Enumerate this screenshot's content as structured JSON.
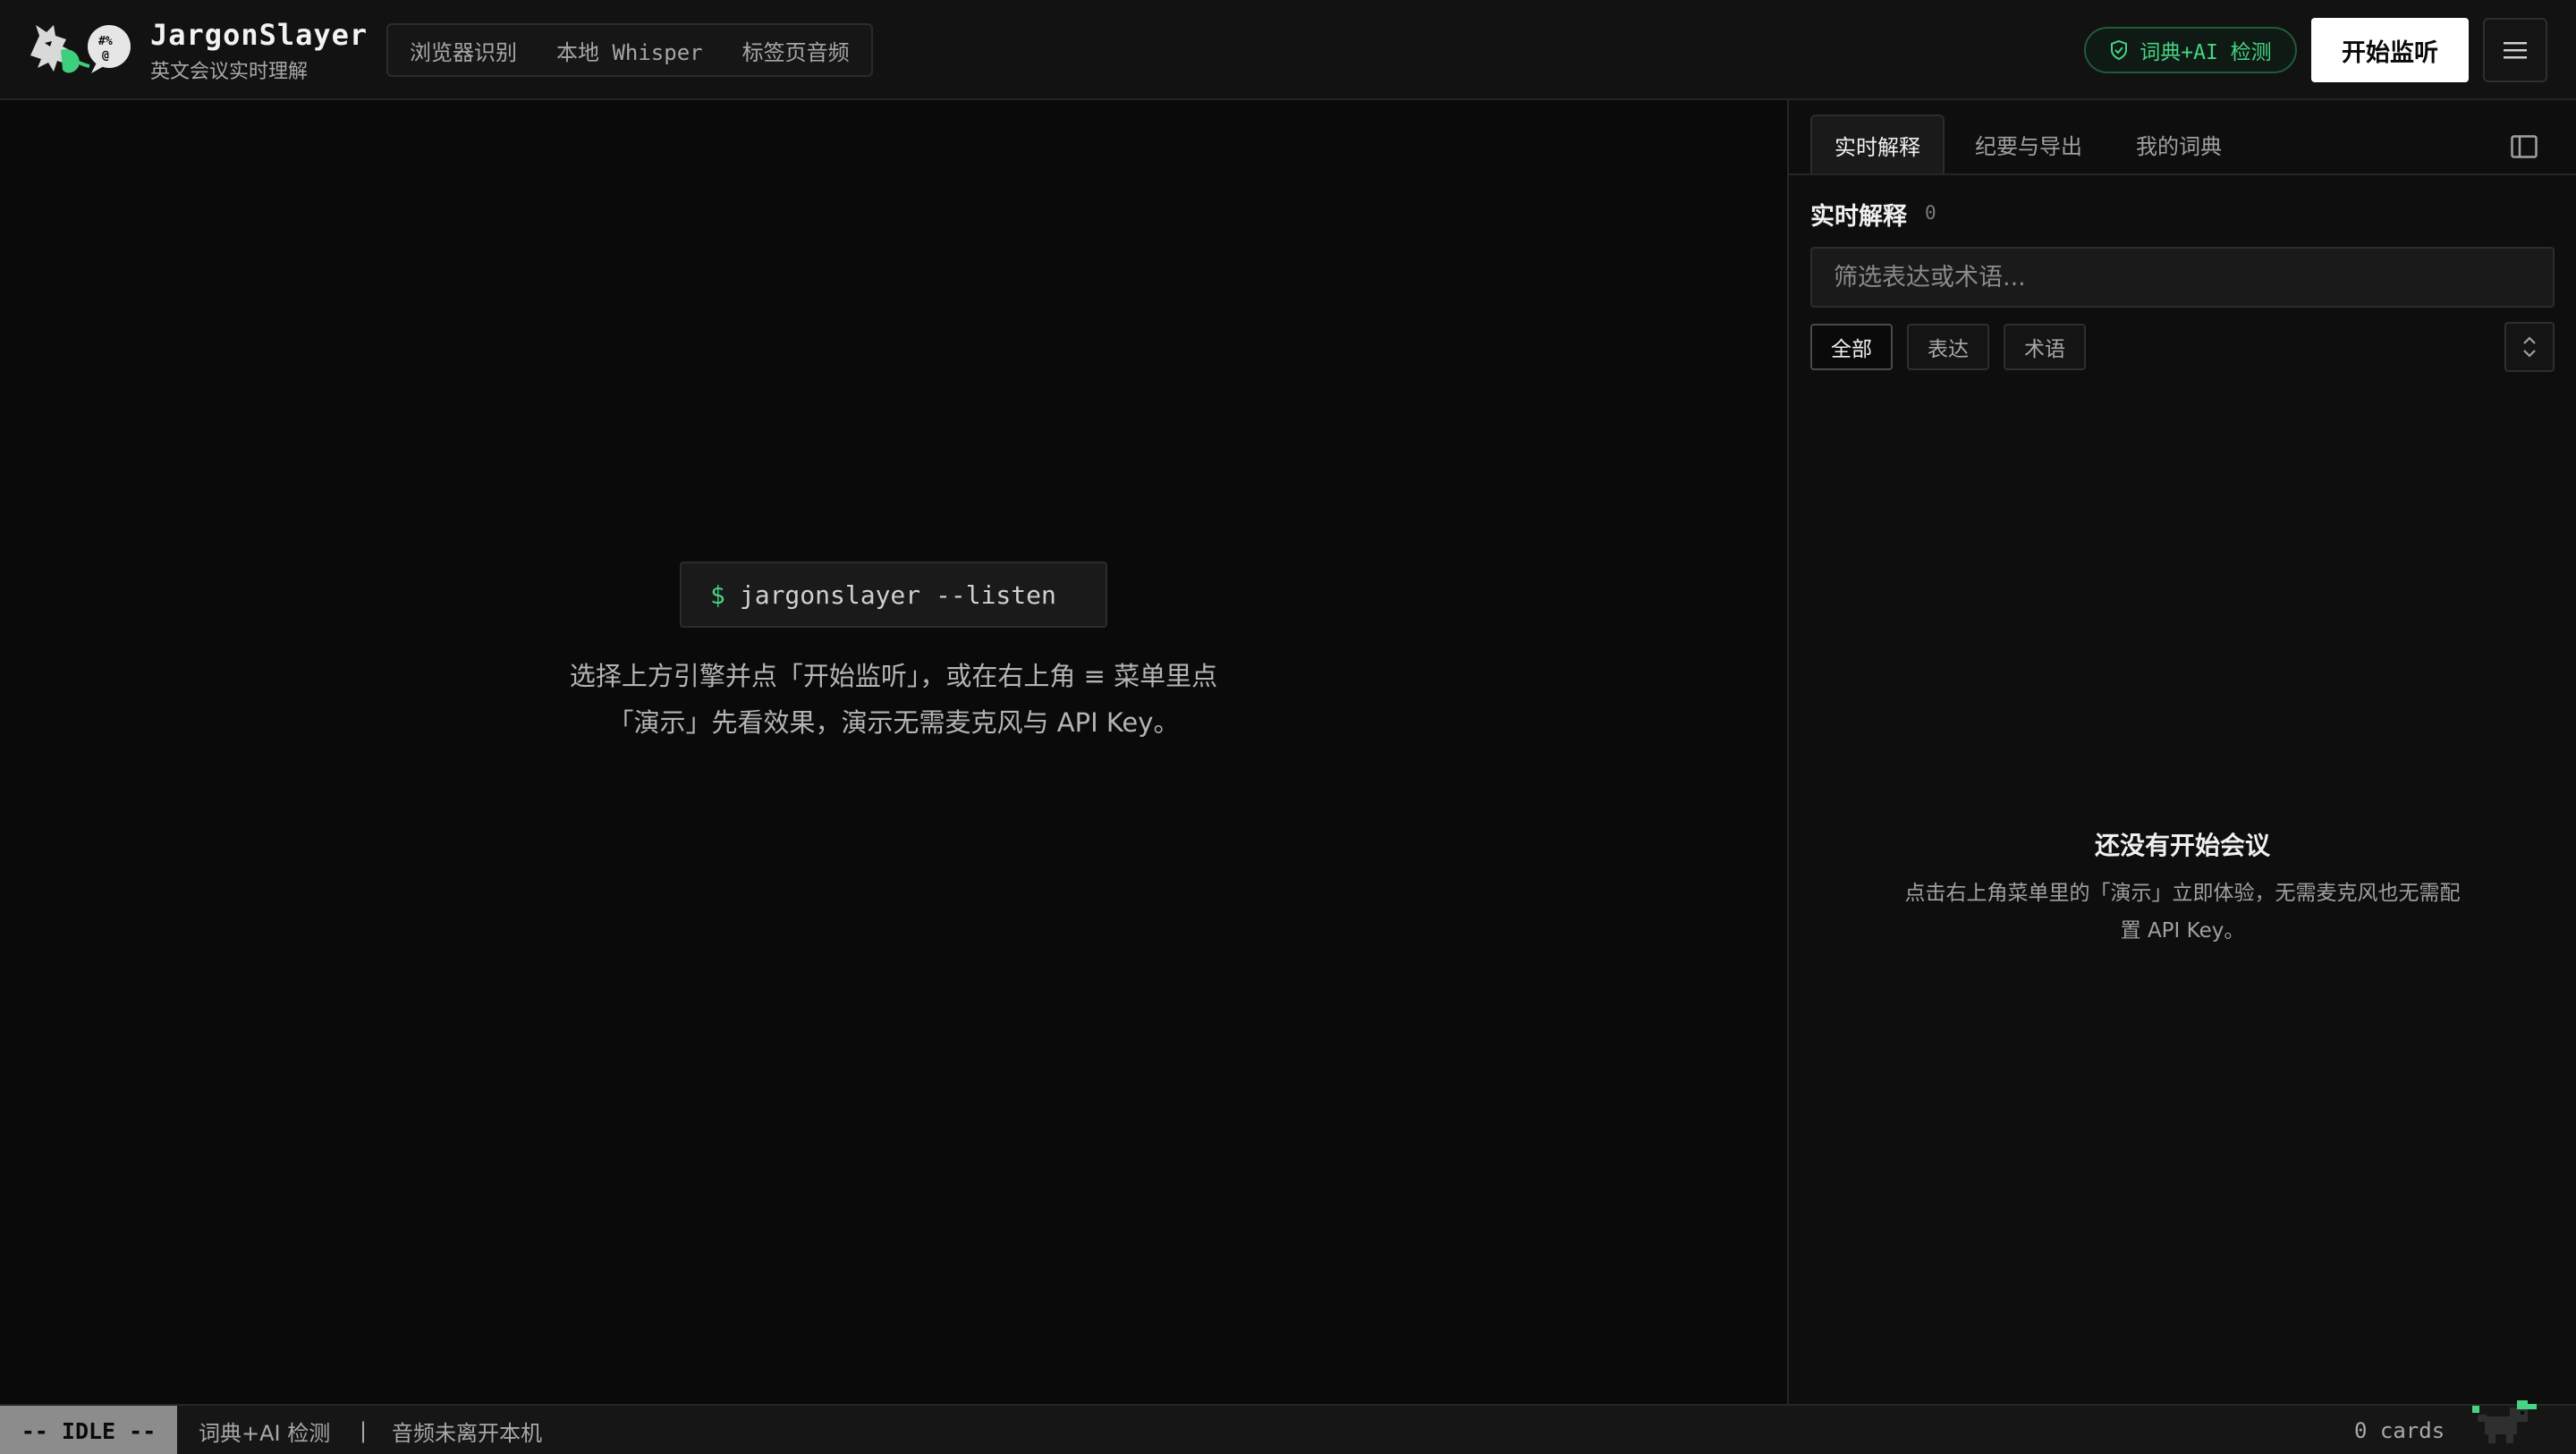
{
  "header": {
    "brand_name": "JargonSlayer",
    "brand_sub": "英文会议实时理解",
    "engines": [
      "浏览器识别",
      "本地 Whisper",
      "标签页音频"
    ],
    "ai_badge": "词典+AI 检测",
    "start_button": "开始监听",
    "icons": {
      "badge": "shield-check-icon",
      "menu": "hamburger-menu-icon"
    }
  },
  "main": {
    "terminal_prompt": "$",
    "terminal_command": "jargonslayer --listen",
    "hint_line1": "选择上方引擎并点「开始监听」，或在右上角 ≡ 菜单里点",
    "hint_line2": "「演示」先看效果，演示无需麦克风与 API Key。"
  },
  "panel": {
    "tabs": [
      "实时解释",
      "纪要与导出",
      "我的词典"
    ],
    "active_tab": "实时解释",
    "section_title": "实时解释",
    "section_count": "0",
    "filter_placeholder": "筛选表达或术语...",
    "chips": [
      "全部",
      "表达",
      "术语"
    ],
    "empty_title": "还没有开始会议",
    "empty_desc": "点击右上角菜单里的「演示」立即体验，无需麦克风也无需配置 API Key。"
  },
  "statusbar": {
    "mode": "-- IDLE --",
    "detect": "词典+AI 检测",
    "separator": "|",
    "audio": "音频未离开本机",
    "cards": "0 cards"
  },
  "colors": {
    "accent_green": "#45d483",
    "background": "#0a0a0a",
    "panel": "#0e0e0e"
  }
}
